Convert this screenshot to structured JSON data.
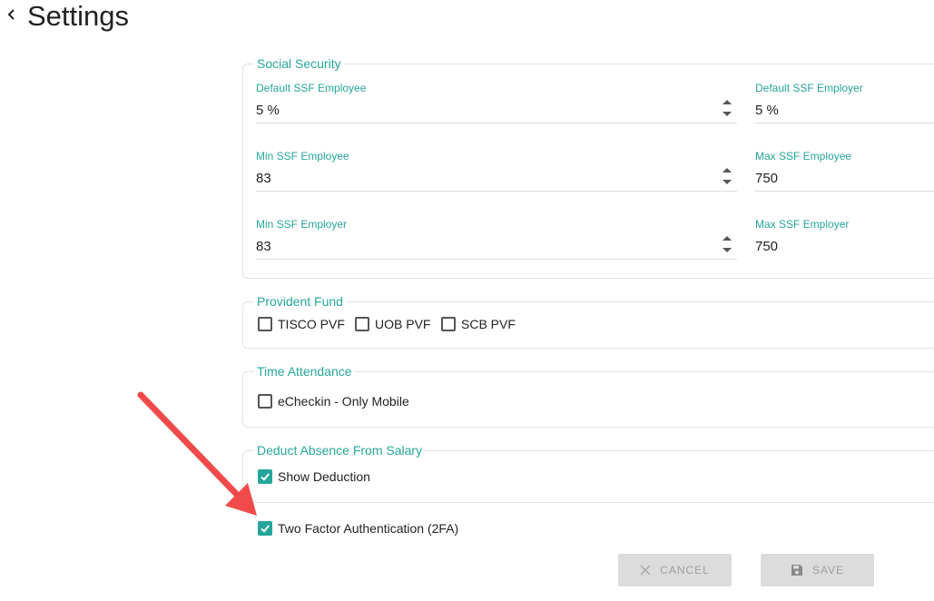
{
  "header": {
    "back_icon": "chevron-left-icon",
    "title": "Settings"
  },
  "social_security": {
    "legend": "Social Security",
    "fields": [
      {
        "label": "Default SSF Employee",
        "value": "5 %"
      },
      {
        "label": "Default SSF Employer",
        "value": "5 %"
      },
      {
        "label": "Min SSF Employee",
        "value": "83"
      },
      {
        "label": "Max SSF Employee",
        "value": "750"
      },
      {
        "label": "Min SSF Employer",
        "value": "83"
      },
      {
        "label": "Max SSF Employer",
        "value": "750"
      }
    ]
  },
  "provident_fund": {
    "legend": "Provident Fund",
    "options": [
      {
        "label": "TISCO PVF",
        "checked": false
      },
      {
        "label": "UOB PVF",
        "checked": false
      },
      {
        "label": "SCB PVF",
        "checked": false
      }
    ]
  },
  "time_attendance": {
    "legend": "Time Attendance",
    "options": [
      {
        "label": "eCheckin - Only Mobile",
        "checked": false
      }
    ]
  },
  "deduct_absence": {
    "legend": "Deduct Absence From Salary",
    "options": [
      {
        "label": "Show Deduction",
        "checked": true
      }
    ]
  },
  "two_factor": {
    "label": "Two Factor Authentication (2FA)",
    "checked": true
  },
  "actions": {
    "cancel_label": "CANCEL",
    "save_label": "SAVE"
  },
  "colors": {
    "accent": "#26a69a",
    "annotation_arrow": "#f04a4a",
    "button_bg": "#dcdcdc"
  }
}
